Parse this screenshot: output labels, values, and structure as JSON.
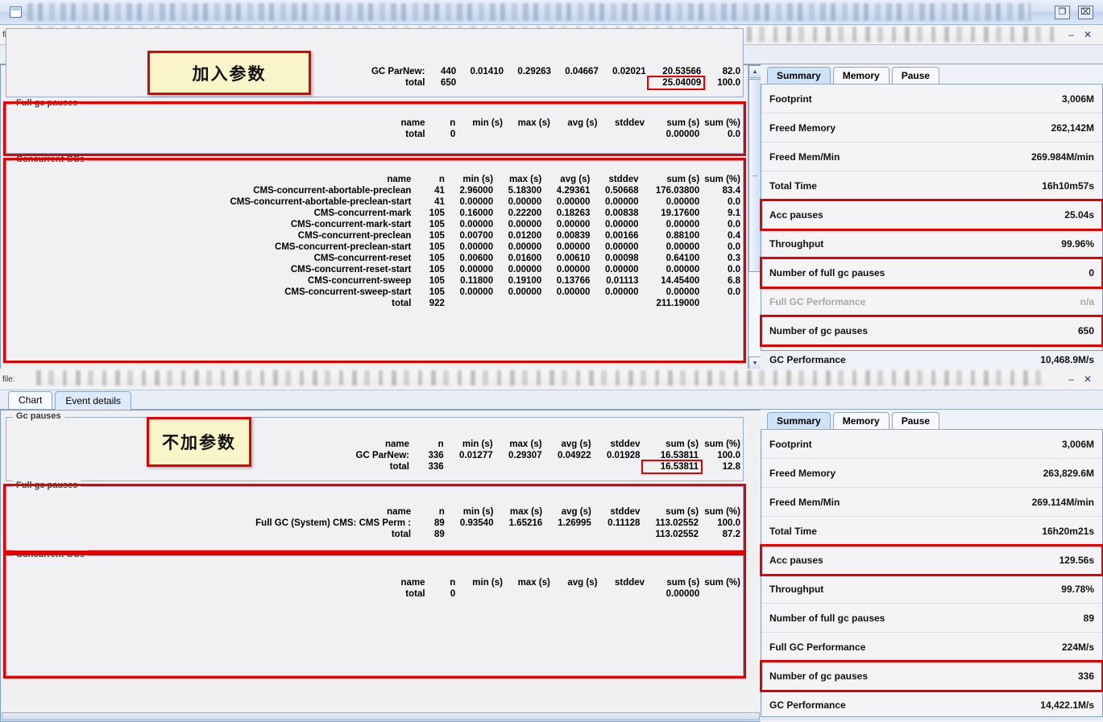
{
  "app": {
    "window_icon": "window-icon",
    "title_top": "/E:",
    "title_bottom": "",
    "path_top": "file:/E:/k",
    "path_bottom": "file:",
    "buttons": {
      "restore": "❐",
      "close": "⌧",
      "minimize": "–",
      "close_small": "✕"
    }
  },
  "tabs": {
    "chart": "Chart",
    "event_details": "Event details"
  },
  "callouts": {
    "top": "加入参数",
    "bottom": "不加参数"
  },
  "sections": {
    "gc_pauses": "Gc pauses",
    "full_gc_pauses": "Full gc pauses",
    "concurrent_gcs": "Concurrent GCs"
  },
  "table_header": {
    "name": "name",
    "n": "n",
    "min": "min (s)",
    "max": "max (s)",
    "avg": "avg (s)",
    "stddev": "stddev",
    "sum": "sum (s)",
    "sum_pct": "sum (%)"
  },
  "total_label": "total",
  "top_window": {
    "gc_pauses": {
      "rows": [
        {
          "name": "GC ParNew:",
          "n": "440",
          "min": "0.01410",
          "max": "0.29263",
          "avg": "0.04667",
          "stddev": "0.02021",
          "sum": "20.53566",
          "sum_pct": "82.0"
        }
      ],
      "total": {
        "n": "650",
        "sum": "25.04009",
        "sum_pct": "100.0"
      }
    },
    "full_gc_pauses": {
      "rows": [],
      "total": {
        "n": "0",
        "sum": "0.00000",
        "sum_pct": "0.0"
      }
    },
    "concurrent_gcs": {
      "rows": [
        {
          "name": "CMS-concurrent-abortable-preclean",
          "n": "41",
          "min": "2.96000",
          "max": "5.18300",
          "avg": "4.29361",
          "stddev": "0.50668",
          "sum": "176.03800",
          "sum_pct": "83.4"
        },
        {
          "name": "CMS-concurrent-abortable-preclean-start",
          "n": "41",
          "min": "0.00000",
          "max": "0.00000",
          "avg": "0.00000",
          "stddev": "0.00000",
          "sum": "0.00000",
          "sum_pct": "0.0"
        },
        {
          "name": "CMS-concurrent-mark",
          "n": "105",
          "min": "0.16000",
          "max": "0.22200",
          "avg": "0.18263",
          "stddev": "0.00838",
          "sum": "19.17600",
          "sum_pct": "9.1"
        },
        {
          "name": "CMS-concurrent-mark-start",
          "n": "105",
          "min": "0.00000",
          "max": "0.00000",
          "avg": "0.00000",
          "stddev": "0.00000",
          "sum": "0.00000",
          "sum_pct": "0.0"
        },
        {
          "name": "CMS-concurrent-preclean",
          "n": "105",
          "min": "0.00700",
          "max": "0.01200",
          "avg": "0.00839",
          "stddev": "0.00166",
          "sum": "0.88100",
          "sum_pct": "0.4"
        },
        {
          "name": "CMS-concurrent-preclean-start",
          "n": "105",
          "min": "0.00000",
          "max": "0.00000",
          "avg": "0.00000",
          "stddev": "0.00000",
          "sum": "0.00000",
          "sum_pct": "0.0"
        },
        {
          "name": "CMS-concurrent-reset",
          "n": "105",
          "min": "0.00600",
          "max": "0.01600",
          "avg": "0.00610",
          "stddev": "0.00098",
          "sum": "0.64100",
          "sum_pct": "0.3"
        },
        {
          "name": "CMS-concurrent-reset-start",
          "n": "105",
          "min": "0.00000",
          "max": "0.00000",
          "avg": "0.00000",
          "stddev": "0.00000",
          "sum": "0.00000",
          "sum_pct": "0.0"
        },
        {
          "name": "CMS-concurrent-sweep",
          "n": "105",
          "min": "0.11800",
          "max": "0.19100",
          "avg": "0.13766",
          "stddev": "0.01113",
          "sum": "14.45400",
          "sum_pct": "6.8"
        },
        {
          "name": "CMS-concurrent-sweep-start",
          "n": "105",
          "min": "0.00000",
          "max": "0.00000",
          "avg": "0.00000",
          "stddev": "0.00000",
          "sum": "0.00000",
          "sum_pct": "0.0"
        }
      ],
      "total": {
        "n": "922",
        "sum": "211.19000",
        "sum_pct": ""
      }
    },
    "summary_tabs": {
      "summary": "Summary",
      "memory": "Memory",
      "pause": "Pause"
    },
    "summary_rows": [
      {
        "label": "Footprint",
        "value": "3,006M",
        "highlight": false,
        "dim": false
      },
      {
        "label": "Freed Memory",
        "value": "262,142M",
        "highlight": false,
        "dim": false
      },
      {
        "label": "Freed Mem/Min",
        "value": "269.984M/min",
        "highlight": false,
        "dim": false
      },
      {
        "label": "Total Time",
        "value": "16h10m57s",
        "highlight": false,
        "dim": false
      },
      {
        "label": "Acc pauses",
        "value": "25.04s",
        "highlight": true,
        "dim": false
      },
      {
        "label": "Throughput",
        "value": "99.96%",
        "highlight": false,
        "dim": false
      },
      {
        "label": "Number of full gc pauses",
        "value": "0",
        "highlight": true,
        "dim": false
      },
      {
        "label": "Full GC Performance",
        "value": "n/a",
        "highlight": false,
        "dim": true
      },
      {
        "label": "Number of gc pauses",
        "value": "650",
        "highlight": true,
        "dim": false
      },
      {
        "label": "GC Performance",
        "value": "10,468.9M/s",
        "highlight": false,
        "dim": false
      }
    ]
  },
  "bottom_window": {
    "gc_pauses": {
      "rows": [
        {
          "name": "GC ParNew:",
          "n": "336",
          "min": "0.01277",
          "max": "0.29307",
          "avg": "0.04922",
          "stddev": "0.01928",
          "sum": "16.53811",
          "sum_pct": "100.0"
        }
      ],
      "total": {
        "n": "336",
        "sum": "16.53811",
        "sum_pct": "12.8"
      }
    },
    "full_gc_pauses": {
      "rows": [
        {
          "name": "Full GC (System) CMS: CMS Perm :",
          "n": "89",
          "min": "0.93540",
          "max": "1.65216",
          "avg": "1.26995",
          "stddev": "0.11128",
          "sum": "113.02552",
          "sum_pct": "100.0"
        }
      ],
      "total": {
        "n": "89",
        "sum": "113.02552",
        "sum_pct": "87.2"
      }
    },
    "concurrent_gcs": {
      "rows": [],
      "total": {
        "n": "0",
        "sum": "0.00000",
        "sum_pct": ""
      }
    },
    "summary_tabs": {
      "summary": "Summary",
      "memory": "Memory",
      "pause": "Pause"
    },
    "summary_rows": [
      {
        "label": "Footprint",
        "value": "3,006M",
        "highlight": false,
        "dim": false
      },
      {
        "label": "Freed Memory",
        "value": "263,829.6M",
        "highlight": false,
        "dim": false
      },
      {
        "label": "Freed Mem/Min",
        "value": "269.114M/min",
        "highlight": false,
        "dim": false
      },
      {
        "label": "Total Time",
        "value": "16h20m21s",
        "highlight": false,
        "dim": false
      },
      {
        "label": "Acc pauses",
        "value": "129.56s",
        "highlight": true,
        "dim": false
      },
      {
        "label": "Throughput",
        "value": "99.78%",
        "highlight": false,
        "dim": false
      },
      {
        "label": "Number of full gc pauses",
        "value": "89",
        "highlight": false,
        "dim": false
      },
      {
        "label": "Full GC Performance",
        "value": "224M/s",
        "highlight": false,
        "dim": false
      },
      {
        "label": "Number of gc pauses",
        "value": "336",
        "highlight": true,
        "dim": false
      },
      {
        "label": "GC Performance",
        "value": "14,422.1M/s",
        "highlight": false,
        "dim": false
      }
    ]
  }
}
